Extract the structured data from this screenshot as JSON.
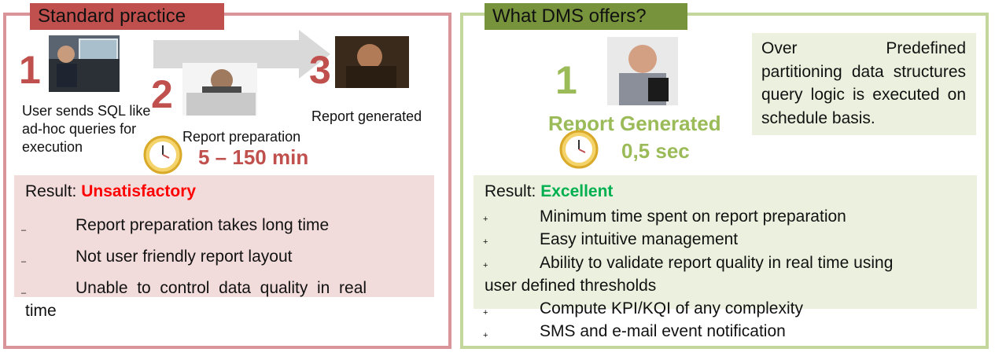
{
  "left": {
    "tab": "Standard practice",
    "step1": {
      "num": "1",
      "text": "User  sends SQL like ad-hoc queries for execution"
    },
    "step2": {
      "num": "2",
      "text": "Report preparation"
    },
    "step3": {
      "num": "3",
      "text": "Report generated"
    },
    "duration": "5 – 150 min",
    "result_label": "Result:",
    "result_value": "Unsatisfactory",
    "items": [
      {
        "marker": "–",
        "text": "Report preparation takes long time"
      },
      {
        "marker": "–",
        "text": "Not user friendly report layout"
      },
      {
        "marker": "–",
        "text": "Unable  to  control  data  quality  in  real"
      }
    ],
    "items_tail": "time"
  },
  "right": {
    "tab": "What DMS offers?",
    "step1": {
      "num": "1",
      "text": "Report Generated"
    },
    "duration": "0,5 sec",
    "description": "Over          Predefined partitioning                data structures      query logic is          executed          on schedule basis.",
    "result_label": "Result:",
    "result_value": "Excellent",
    "items": [
      {
        "marker": "+",
        "text": "Minimum time spent on report preparation"
      },
      {
        "marker": "+",
        "text": "Easy intuitive management"
      },
      {
        "marker": "+",
        "text": "Ability to validate report quality in real time using"
      },
      {
        "marker": "+",
        "text": "Compute KPI/KQI of any complexity"
      },
      {
        "marker": "+",
        "text": "SMS and e-mail event notification"
      }
    ],
    "item3_tail": "user defined thresholds"
  },
  "colors": {
    "left_border": "#d9959a",
    "left_tab": "#c0504d",
    "right_border": "#c3d69b",
    "right_tab": "#77933c",
    "unsatisfactory": "#ff0000",
    "excellent": "#00b050"
  },
  "icons": [
    "clock-icon",
    "arrow-icon"
  ]
}
